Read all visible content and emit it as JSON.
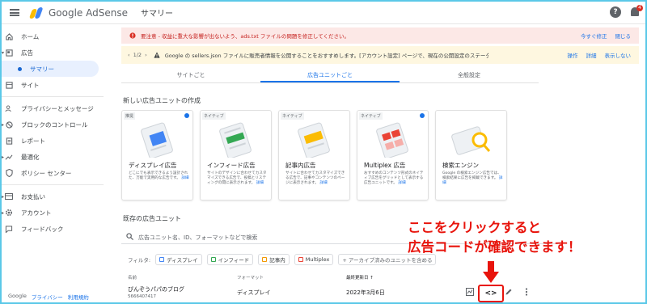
{
  "topbar": {
    "brand": "Google AdSense",
    "title": "サマリー"
  },
  "sidebar": {
    "items": [
      {
        "label": "ホーム",
        "icon": "home-icon"
      },
      {
        "label": "広告",
        "icon": "ads-icon"
      },
      {
        "label": "サマリー",
        "icon": "dot"
      },
      {
        "label": "サイト",
        "icon": "site-icon"
      },
      {
        "label": "プライバシーとメッセージ",
        "icon": "privacy-icon"
      },
      {
        "label": "ブロックのコントロール",
        "icon": "block-icon"
      },
      {
        "label": "レポート",
        "icon": "report-icon"
      },
      {
        "label": "最適化",
        "icon": "optimize-icon"
      },
      {
        "label": "ポリシー センター",
        "icon": "policy-icon"
      },
      {
        "label": "お支払い",
        "icon": "payment-icon"
      },
      {
        "label": "アカウント",
        "icon": "gear-icon"
      },
      {
        "label": "フィードバック",
        "icon": "feedback-icon"
      }
    ],
    "footer": {
      "google": "Google",
      "privacy": "プライバシー",
      "terms": "利用規約"
    }
  },
  "alerts": {
    "first": {
      "text": "要注意 - 収益に重大な影響が出ないよう、ads.txt ファイルの問題を修正してください。",
      "link": "今すぐ修正",
      "close": "閉じる"
    },
    "second": {
      "pager": "1/2",
      "text": "Google の sellers.json ファイルに販売者情報を公開することをおすすめします。[アカウント設定] ページで、現在の公開設定のステータスをご確認ください。",
      "links": [
        "操作",
        "詳細",
        "表示しない"
      ]
    }
  },
  "tabs": [
    "サイトごと",
    "広告ユニットごと",
    "全般設定"
  ],
  "new_section": {
    "title": "新しい広告ユニットの作成"
  },
  "cards": [
    {
      "chip": "推奨",
      "title": "ディスプレイ広告",
      "desc": "どこにでも表示できるよう設計された、万能で実用的な広告です。",
      "more": "詳細",
      "color": "#4285f4"
    },
    {
      "chip": "ネイティブ",
      "title": "インフィード広告",
      "desc": "サイトのデザインに合わせてカスタマイズできる広告で、投稿とリスティングの間に表示されます。",
      "more": "詳細",
      "color": "#34a853"
    },
    {
      "chip": "ネイティブ",
      "title": "記事内広告",
      "desc": "サイトに合わせてカスタマイズできる広告で、記事やコンテンツのページに表示されます。",
      "more": "詳細",
      "color": "#fbbc04"
    },
    {
      "chip": "ネイティブ",
      "title": "Multiplex 広告",
      "desc": "おすすめのコンテンツ形式のネイティブ広告をグリッドとして表示する広告ユニットです。",
      "more": "詳細",
      "color": "#ea4335"
    },
    {
      "chip": "",
      "title": "検索エンジン",
      "desc": "Google の検索エンジン広告では、検索結果に広告を掲載できます。",
      "more": "詳細",
      "color": "#fbbc04"
    }
  ],
  "existing_section": {
    "title": "既存の広告ユニット"
  },
  "search": {
    "placeholder": "広告ユニット名、ID、フォーマットなどで検索"
  },
  "filters": {
    "label": "フィルタ:",
    "chips": [
      {
        "label": "ディスプレイ",
        "color": "#4285f4"
      },
      {
        "label": "インフィード",
        "color": "#34a853"
      },
      {
        "label": "記事内",
        "color": "#f29900"
      },
      {
        "label": "Multiplex",
        "color": "#ea4335"
      }
    ],
    "archive": "+ アーカイブ済みのユニットを含める"
  },
  "table": {
    "headers": {
      "name": "名前",
      "format": "フォーマット",
      "updated": "最終更新日 ↑"
    },
    "row": {
      "name": "ぴんぞうパパのブログ",
      "id": "5666407417",
      "format": "ディスプレイ",
      "date": "2022年3月6日"
    }
  },
  "overlay": {
    "line1": "ここをクリックすると",
    "line2": "広告コードが確認できます！"
  },
  "code_button": "<>"
}
